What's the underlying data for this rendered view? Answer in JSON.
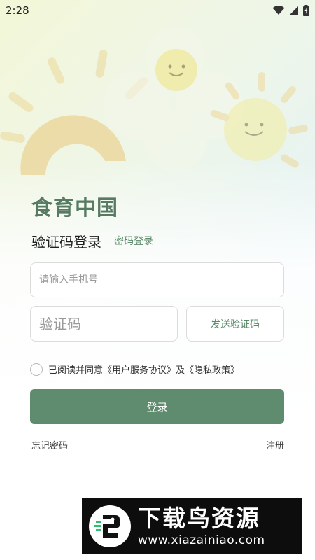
{
  "status_bar": {
    "time": "2:28"
  },
  "app": {
    "title": "食育中国"
  },
  "login": {
    "mode_title": "验证码登录",
    "password_login_link": "密码登录",
    "phone_placeholder": "请输入手机号",
    "code_placeholder": "验证码",
    "send_code_label": "发送验证码",
    "agreement_text": "已阅读并同意《用户服务协议》及《隐私政策》",
    "login_button": "登录",
    "forgot_password": "忘记密码",
    "register": "注册"
  },
  "watermark": {
    "title": "下载鸟资源",
    "url": "www.xiazainiao.com"
  },
  "colors": {
    "accent": "#5f8b6e",
    "title": "#567a62",
    "link": "#5b8a6a"
  }
}
